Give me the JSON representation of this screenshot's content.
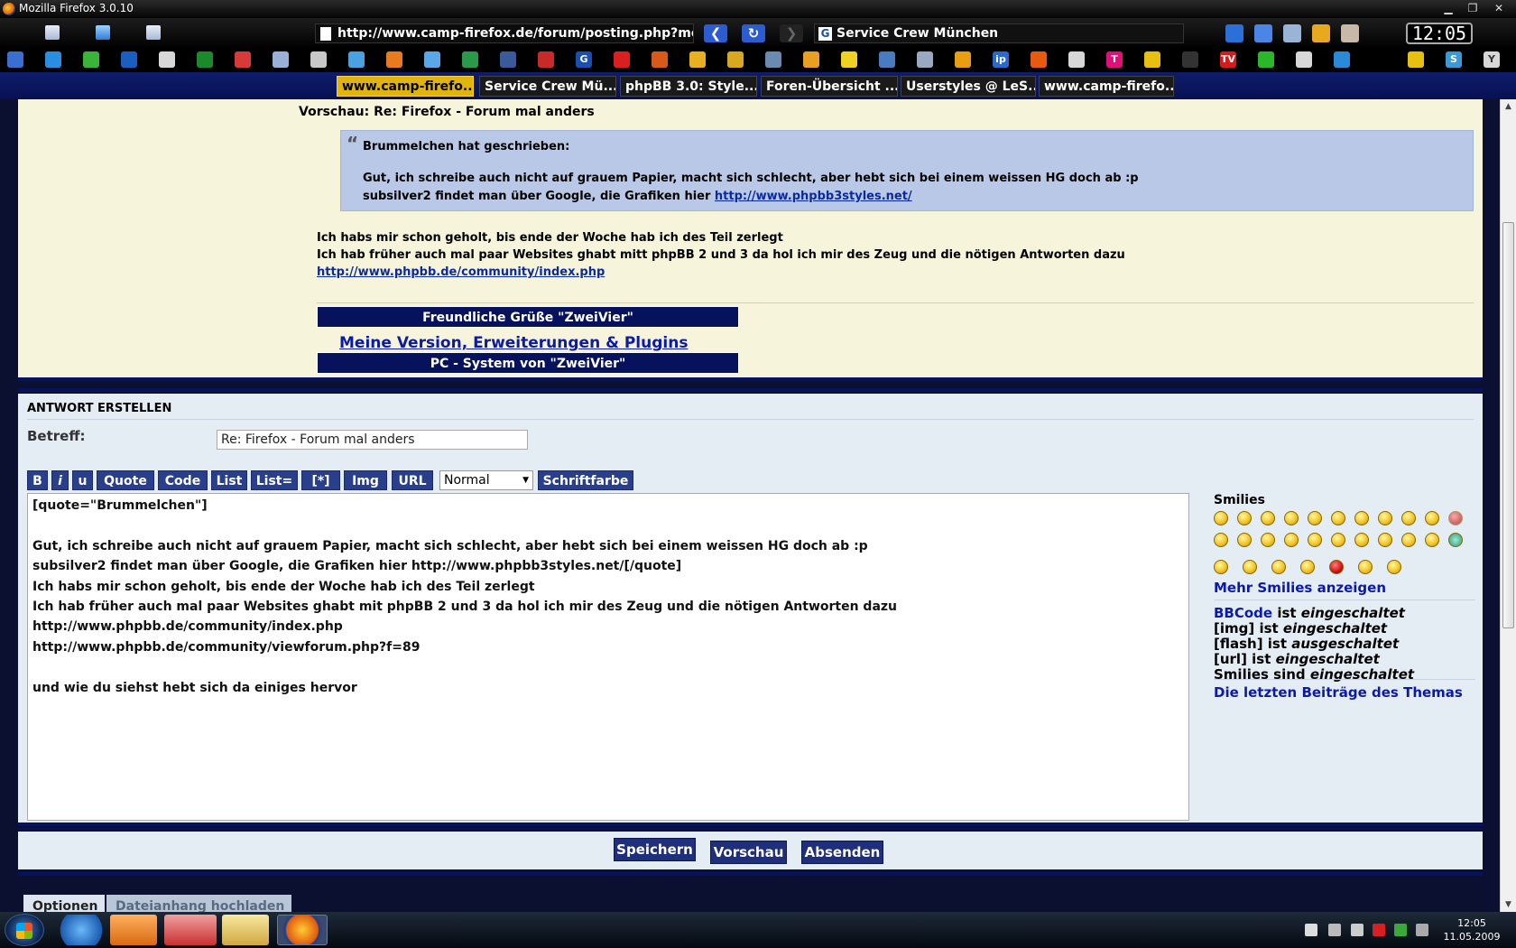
{
  "window": {
    "title": "Mozilla Firefox 3.0.10",
    "min": "▁",
    "max": "❐",
    "close": "✕"
  },
  "nav": {
    "url": "http://www.camp-firefox.de/forum/posting.php?mo",
    "search": "Service Crew München",
    "clock": "12:05"
  },
  "tabs": [
    {
      "label": "www.camp-firefo..."
    },
    {
      "label": "Service Crew Mü..."
    },
    {
      "label": "phpBB 3.0: Style..."
    },
    {
      "label": "Foren-Übersicht ..."
    },
    {
      "label": "Userstyles @ LeS..."
    },
    {
      "label": "www.camp-firefo..."
    }
  ],
  "preview": {
    "title": "Vorschau: Re: Firefox - Forum mal anders",
    "quote_mark": "“",
    "quote_author": "Brummelchen hat geschrieben:",
    "quote_line1": "Gut, ich schreibe auch nicht auf grauem Papier, macht sich schlecht, aber hebt sich bei einem weissen HG doch ab :p",
    "quote_line2_prefix": "subsilver2 findet man über Google, die Grafiken hier ",
    "quote_link": "http://www.phpbb3styles.net/",
    "text1": "Ich habs mir schon geholt, bis ende der Woche hab ich des Teil zerlegt",
    "text2": "Ich hab früher auch mal paar Websites ghabt mitt phpBB 2 und 3 da hol ich mir des Zeug und die nötigen Antworten dazu",
    "link": "http://www.phpbb.de/community/index.php",
    "sig_greeting": "Freundliche Grüße \"ZweiVier\"",
    "sig_link": "Meine Version, Erweiterungen & Plugins",
    "sig_system": "PC - System von \"ZweiVier\""
  },
  "reply": {
    "heading": "ANTWORT ERSTELLEN",
    "subject_label": "Betreff:",
    "subject_value": "Re: Firefox - Forum mal anders",
    "toolbar": {
      "bold": "B",
      "italic": "i",
      "underline": "u",
      "quote": "Quote",
      "code": "Code",
      "list": "List",
      "list_eq": "List=",
      "list_item": "[*]",
      "img": "Img",
      "url": "URL",
      "font_size": "Normal",
      "font_color": "Schriftfarbe"
    },
    "message": "[quote=\"Brummelchen\"]\n\nGut, ich schreibe auch nicht auf grauem Papier, macht sich schlecht, aber hebt sich bei einem weissen HG doch ab :p\nsubsilver2 findet man über Google, die Grafiken hier http://www.phpbb3styles.net/[/quote]\nIch habs mir schon geholt, bis ende der Woche hab ich des Teil zerlegt\nIch hab früher auch mal paar Websites ghabt mit phpBB 2 und 3 da hol ich mir des Zeug und die nötigen Antworten dazu\nhttp://www.phpbb.de/community/index.php\nhttp://www.phpbb.de/community/viewforum.php?f=89\n\nund wie du siehst hebt sich da einiges hervor",
    "smilies_heading": "Smilies",
    "more_smilies": "Mehr Smilies anzeigen",
    "status": {
      "bbcode_label": "BBCode",
      "bbcode_is": " ist ",
      "bbcode_state": "eingeschaltet",
      "img_label": "[img] ist ",
      "img_state": "eingeschaltet",
      "flash_label": "[flash] ist ",
      "flash_state": "ausgeschaltet",
      "url_label": "[url] ist ",
      "url_state": "eingeschaltet",
      "smilies_label": "Smilies sind ",
      "smilies_state": "eingeschaltet"
    },
    "last_posts": "Die letzten Beiträge des Themas"
  },
  "actions": {
    "save": "Speichern",
    "preview": "Vorschau",
    "submit": "Absenden"
  },
  "bottom_tabs": {
    "options": "Optionen",
    "upload": "Dateianhang hochladen"
  },
  "taskbar": {
    "time": "12:05",
    "date": "11.05.2009"
  },
  "colors": {
    "accent": "#07125c",
    "tab_active": "#e0b40c",
    "link": "#0b1aa8"
  }
}
